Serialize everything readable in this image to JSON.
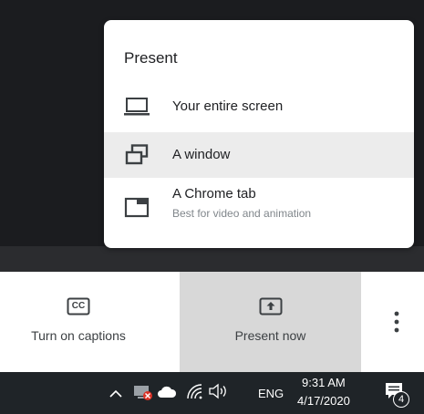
{
  "menu": {
    "title": "Present",
    "items": [
      {
        "label": "Your entire screen",
        "icon": "laptop-icon"
      },
      {
        "label": "A window",
        "icon": "window-stack-icon"
      },
      {
        "label": "A Chrome tab",
        "sublabel": "Best for video and animation",
        "icon": "browser-tab-icon"
      }
    ]
  },
  "controls": {
    "captions": {
      "label": "Turn on captions",
      "icon": "closed-captions-icon",
      "icon_text": "CC"
    },
    "present": {
      "label": "Present now",
      "icon": "present-screen-icon"
    },
    "more": {
      "icon": "more-vert-icon"
    }
  },
  "taskbar": {
    "language": "ENG",
    "time": "9:31 AM",
    "date": "4/17/2020",
    "notification_count": "4"
  },
  "colors": {
    "menu_hover": "#ececec",
    "present_active": "#d8d8d8",
    "taskbar": "#1f2428",
    "stage": "#1b1c1f"
  }
}
